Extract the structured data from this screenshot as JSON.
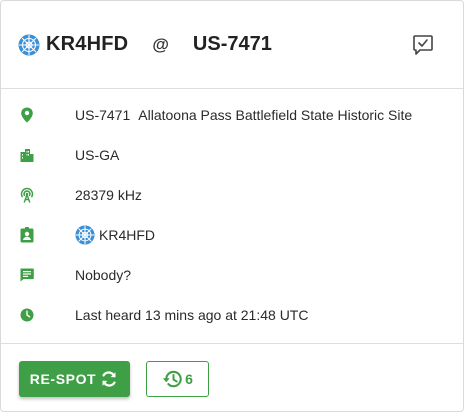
{
  "colors": {
    "accent": "#3f9f47",
    "flag_blue": "#3b8fd6"
  },
  "header": {
    "activator_callsign": "KR4HFD",
    "at_symbol": "@",
    "park_ref": "US-7471",
    "flag_icon": "us-flag-globe-icon",
    "comment_icon": "comment-check-icon"
  },
  "details": [
    {
      "icon": "map-pin-icon",
      "park_ref": "US-7471",
      "park_name": "Allatoona Pass Battlefield State Historic Site"
    },
    {
      "icon": "city-icon",
      "value": "US-GA"
    },
    {
      "icon": "antenna-icon",
      "value": "28379 kHz"
    },
    {
      "icon": "contact-badge-icon",
      "flag_icon": "us-flag-globe-icon",
      "value": "KR4HFD"
    },
    {
      "icon": "comment-icon",
      "value": "Nobody?"
    },
    {
      "icon": "clock-icon",
      "value": "Last heard 13 mins ago at 21:48 UTC"
    }
  ],
  "footer": {
    "respot_label": "RE-SPOT",
    "respot_icon": "refresh-icon",
    "history_icon": "history-icon",
    "history_count": "6"
  }
}
